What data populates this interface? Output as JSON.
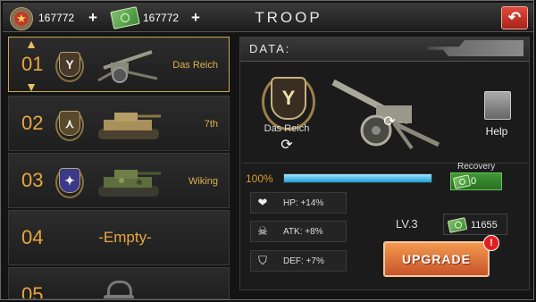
{
  "header": {
    "title": "TROOP",
    "medal_amount": "167772",
    "cash_amount": "167772",
    "plus_label": "+",
    "back_glyph": "↶"
  },
  "troops": [
    {
      "number": "01",
      "division": "Das Reich",
      "emblem_glyph": "Y",
      "emblem_color": "#4a3a2a",
      "unit_type": "howitzer",
      "selected": true
    },
    {
      "number": "02",
      "division": "7th",
      "emblem_glyph": "⋏",
      "emblem_color": "#5a4a2a",
      "unit_type": "tank-desert"
    },
    {
      "number": "03",
      "division": "Wiking",
      "emblem_glyph": "✦",
      "emblem_color": "#3a3a8a",
      "unit_type": "tank-camo"
    },
    {
      "number": "04",
      "empty_label": "-Empty-"
    },
    {
      "number": "05",
      "locked": true
    }
  ],
  "arrows": {
    "up": "▲",
    "down": "▼"
  },
  "data_panel": {
    "header": "DATA:",
    "division_name": "Das Reich",
    "emblem_glyph": "Y",
    "help_label": "Help",
    "health_percent_label": "100%",
    "health_fraction": 1.0,
    "recovery_label": "Recovery",
    "recovery_value": "0",
    "stats": [
      {
        "icon": "heart-icon",
        "glyph": "❤",
        "label": "HP: +14%"
      },
      {
        "icon": "skull-icon",
        "glyph": "☠",
        "label": "ATK: +8%"
      },
      {
        "icon": "shield-icon",
        "glyph": "⛉",
        "label": "DEF: +7%"
      }
    ],
    "level": "LV.3",
    "upgrade_cost": "11655",
    "upgrade_label": "UPGRADE",
    "alert_glyph": "!"
  },
  "colors": {
    "accent_orange": "#e8a640",
    "health_blue": "#1f9fd6",
    "upgrade": "#e07a3a",
    "back": "#c8302a"
  }
}
